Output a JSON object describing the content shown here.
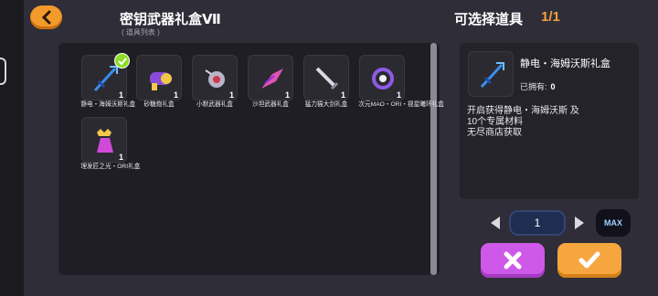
{
  "header": {
    "title": "密钥武器礼盒Ⅶ",
    "subtitle": "( 道具列表 )",
    "selectable_label": "可选择道具",
    "selectable_count": "1/1"
  },
  "items": [
    {
      "name": "静电・海姆沃斯礼盒",
      "qty": "1",
      "icon": "blue-trident-icon",
      "selected": true
    },
    {
      "name": "砂糖炮礼盒",
      "qty": "1",
      "icon": "candy-cannon-icon"
    },
    {
      "name": "小默武器礼盒",
      "qty": "1",
      "icon": "orb-weapon-icon"
    },
    {
      "name": "沙坦武器礼盒",
      "qty": "1",
      "icon": "pink-blade-icon"
    },
    {
      "name": "猛力猫大剑礼盒",
      "qty": "1",
      "icon": "silver-sword-icon"
    },
    {
      "name": "次元MAO・ORI・视星曦环礼盒",
      "qty": "1",
      "icon": "purple-ring-icon"
    },
    {
      "name": "理发匠之光・ORI礼盒",
      "qty": "1",
      "icon": "crown-crystal-icon"
    }
  ],
  "detail": {
    "name": "静电・海姆沃斯礼盒",
    "owned_label": "已拥有:",
    "owned_value": "0",
    "desc_line1": "开启获得静电・海姆沃斯 及",
    "desc_line2": "10个专属材料",
    "desc_line3": "无尽商店获取"
  },
  "quantity": {
    "value": "1",
    "max_label": "MAX"
  },
  "colors": {
    "accent_orange": "#f5a63f",
    "cancel_purple": "#ce59e8",
    "check_green": "#8edb2a"
  }
}
